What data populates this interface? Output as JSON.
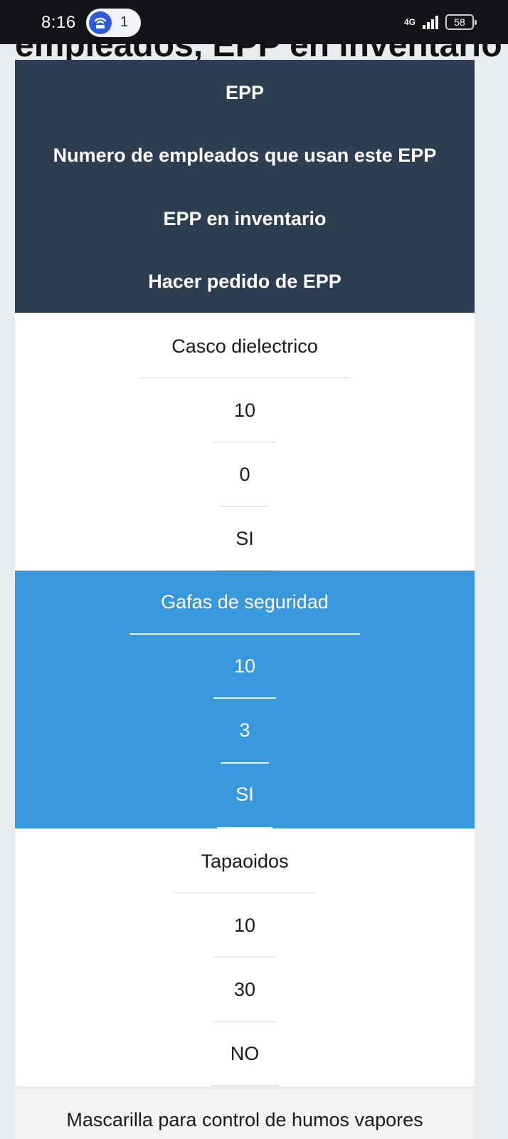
{
  "status_bar": {
    "time": "8:16",
    "notification_count": "1",
    "network": "4G",
    "battery": "58"
  },
  "page": {
    "title_partial": "empleados, EPP en inventario"
  },
  "table": {
    "headers": [
      "EPP",
      "Numero de empleados que usan este EPP",
      "EPP en inventario",
      "Hacer pedido de EPP"
    ],
    "rows": [
      {
        "epp": "Casco dielectrico",
        "empleados": "10",
        "inventario": "0",
        "pedido": "SI"
      },
      {
        "epp": "Gafas de seguridad",
        "empleados": "10",
        "inventario": "3",
        "pedido": "SI"
      },
      {
        "epp": "Tapaoidos",
        "empleados": "10",
        "inventario": "30",
        "pedido": "NO"
      },
      {
        "epp": "Mascarilla para control de humos vapores"
      }
    ]
  },
  "colors": {
    "header_bg": "#2e3e52",
    "highlight_row": "#3898db"
  }
}
